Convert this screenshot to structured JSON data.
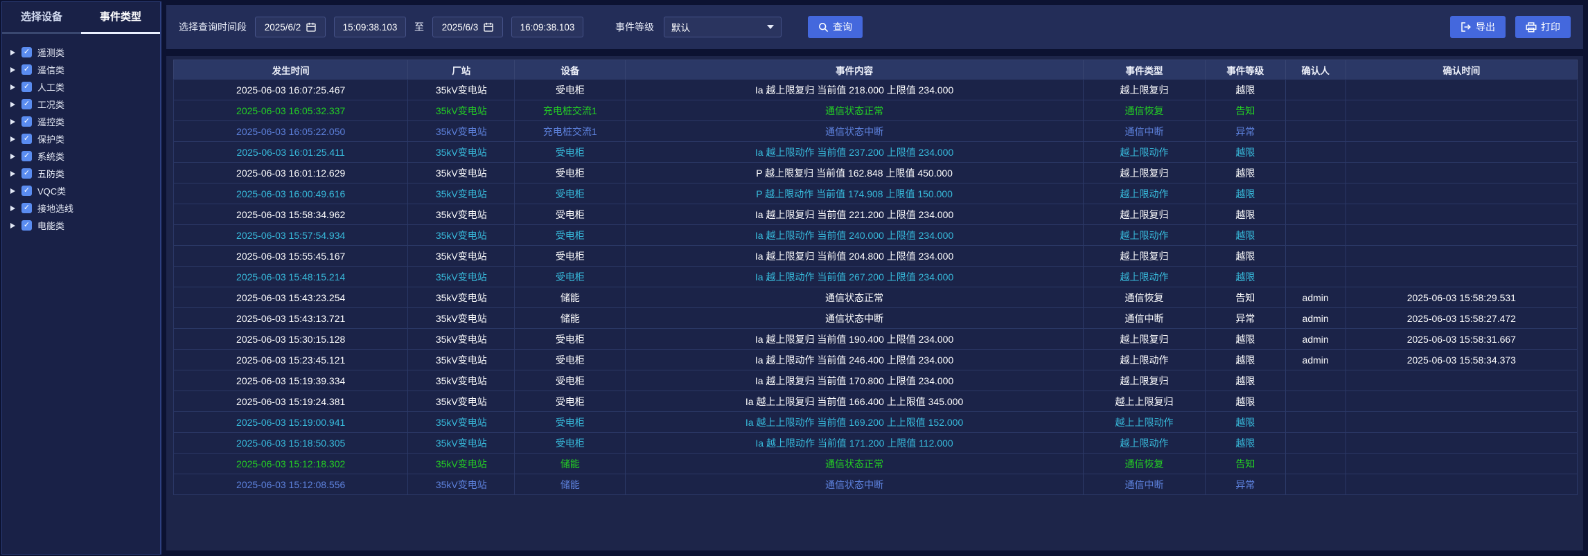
{
  "sidebar": {
    "tabs": [
      {
        "label": "选择设备",
        "active": false
      },
      {
        "label": "事件类型",
        "active": true
      }
    ],
    "tree_items": [
      "遥测类",
      "遥信类",
      "人工类",
      "工况类",
      "遥控类",
      "保护类",
      "系统类",
      "五防类",
      "VQC类",
      "接地选线",
      "电能类"
    ]
  },
  "toolbar": {
    "time_range_label": "选择查询时间段",
    "start_date": "2025/6/2",
    "start_time": "15:09:38.103",
    "to_label": "至",
    "end_date": "2025/6/3",
    "end_time": "16:09:38.103",
    "event_level_label": "事件等级",
    "event_level_value": "默认",
    "query_label": "查询",
    "export_label": "导出",
    "print_label": "打印"
  },
  "table": {
    "columns": [
      "发生时间",
      "厂站",
      "设备",
      "事件内容",
      "事件类型",
      "事件等级",
      "确认人",
      "确认时间"
    ],
    "rows": [
      {
        "time": "2025-06-03 16:07:25.467",
        "station": "35kV变电站",
        "device": "受电柜",
        "content": "Ia 越上限复归 当前值 218.000 上限值 234.000",
        "type": "越上限复归",
        "level": "越限",
        "confirmer": "",
        "confirm_time": "",
        "color": "white"
      },
      {
        "time": "2025-06-03 16:05:32.337",
        "station": "35kV变电站",
        "device": "充电桩交流1",
        "content": "通信状态正常",
        "type": "通信恢复",
        "level": "告知",
        "confirmer": "",
        "confirm_time": "",
        "color": "green"
      },
      {
        "time": "2025-06-03 16:05:22.050",
        "station": "35kV变电站",
        "device": "充电桩交流1",
        "content": "通信状态中断",
        "type": "通信中断",
        "level": "异常",
        "confirmer": "",
        "confirm_time": "",
        "color": "blue"
      },
      {
        "time": "2025-06-03 16:01:25.411",
        "station": "35kV变电站",
        "device": "受电柜",
        "content": "Ia 越上限动作 当前值 237.200 上限值 234.000",
        "type": "越上限动作",
        "level": "越限",
        "confirmer": "",
        "confirm_time": "",
        "color": "cyan"
      },
      {
        "time": "2025-06-03 16:01:12.629",
        "station": "35kV变电站",
        "device": "受电柜",
        "content": "P 越上限复归 当前值 162.848 上限值 450.000",
        "type": "越上限复归",
        "level": "越限",
        "confirmer": "",
        "confirm_time": "",
        "color": "white"
      },
      {
        "time": "2025-06-03 16:00:49.616",
        "station": "35kV变电站",
        "device": "受电柜",
        "content": "P 越上限动作 当前值 174.908 上限值 150.000",
        "type": "越上限动作",
        "level": "越限",
        "confirmer": "",
        "confirm_time": "",
        "color": "cyan"
      },
      {
        "time": "2025-06-03 15:58:34.962",
        "station": "35kV变电站",
        "device": "受电柜",
        "content": "Ia 越上限复归 当前值 221.200 上限值 234.000",
        "type": "越上限复归",
        "level": "越限",
        "confirmer": "",
        "confirm_time": "",
        "color": "white"
      },
      {
        "time": "2025-06-03 15:57:54.934",
        "station": "35kV变电站",
        "device": "受电柜",
        "content": "Ia 越上限动作 当前值 240.000 上限值 234.000",
        "type": "越上限动作",
        "level": "越限",
        "confirmer": "",
        "confirm_time": "",
        "color": "cyan"
      },
      {
        "time": "2025-06-03 15:55:45.167",
        "station": "35kV变电站",
        "device": "受电柜",
        "content": "Ia 越上限复归 当前值 204.800 上限值 234.000",
        "type": "越上限复归",
        "level": "越限",
        "confirmer": "",
        "confirm_time": "",
        "color": "white"
      },
      {
        "time": "2025-06-03 15:48:15.214",
        "station": "35kV变电站",
        "device": "受电柜",
        "content": "Ia 越上限动作 当前值 267.200 上限值 234.000",
        "type": "越上限动作",
        "level": "越限",
        "confirmer": "",
        "confirm_time": "",
        "color": "cyan"
      },
      {
        "time": "2025-06-03 15:43:23.254",
        "station": "35kV变电站",
        "device": "储能",
        "content": "通信状态正常",
        "type": "通信恢复",
        "level": "告知",
        "confirmer": "admin",
        "confirm_time": "2025-06-03 15:58:29.531",
        "color": "white"
      },
      {
        "time": "2025-06-03 15:43:13.721",
        "station": "35kV变电站",
        "device": "储能",
        "content": "通信状态中断",
        "type": "通信中断",
        "level": "异常",
        "confirmer": "admin",
        "confirm_time": "2025-06-03 15:58:27.472",
        "color": "white"
      },
      {
        "time": "2025-06-03 15:30:15.128",
        "station": "35kV变电站",
        "device": "受电柜",
        "content": "Ia 越上限复归 当前值 190.400 上限值 234.000",
        "type": "越上限复归",
        "level": "越限",
        "confirmer": "admin",
        "confirm_time": "2025-06-03 15:58:31.667",
        "color": "white"
      },
      {
        "time": "2025-06-03 15:23:45.121",
        "station": "35kV变电站",
        "device": "受电柜",
        "content": "Ia 越上限动作 当前值 246.400 上限值 234.000",
        "type": "越上限动作",
        "level": "越限",
        "confirmer": "admin",
        "confirm_time": "2025-06-03 15:58:34.373",
        "color": "white"
      },
      {
        "time": "2025-06-03 15:19:39.334",
        "station": "35kV变电站",
        "device": "受电柜",
        "content": "Ia 越上限复归 当前值 170.800 上限值 234.000",
        "type": "越上限复归",
        "level": "越限",
        "confirmer": "",
        "confirm_time": "",
        "color": "white"
      },
      {
        "time": "2025-06-03 15:19:24.381",
        "station": "35kV变电站",
        "device": "受电柜",
        "content": "Ia 越上上限复归 当前值 166.400 上上限值 345.000",
        "type": "越上上限复归",
        "level": "越限",
        "confirmer": "",
        "confirm_time": "",
        "color": "white"
      },
      {
        "time": "2025-06-03 15:19:00.941",
        "station": "35kV变电站",
        "device": "受电柜",
        "content": "Ia 越上上限动作 当前值 169.200 上上限值 152.000",
        "type": "越上上限动作",
        "level": "越限",
        "confirmer": "",
        "confirm_time": "",
        "color": "cyan"
      },
      {
        "time": "2025-06-03 15:18:50.305",
        "station": "35kV变电站",
        "device": "受电柜",
        "content": "Ia 越上限动作 当前值 171.200 上限值 112.000",
        "type": "越上限动作",
        "level": "越限",
        "confirmer": "",
        "confirm_time": "",
        "color": "cyan"
      },
      {
        "time": "2025-06-03 15:12:18.302",
        "station": "35kV变电站",
        "device": "储能",
        "content": "通信状态正常",
        "type": "通信恢复",
        "level": "告知",
        "confirmer": "",
        "confirm_time": "",
        "color": "green"
      },
      {
        "time": "2025-06-03 15:12:08.556",
        "station": "35kV变电站",
        "device": "储能",
        "content": "通信状态中断",
        "type": "通信中断",
        "level": "异常",
        "confirmer": "",
        "confirm_time": "",
        "color": "blue"
      }
    ]
  },
  "colors": {
    "white": "#ffffff",
    "green": "#24cf24",
    "cyan": "#38bbdc",
    "blue": "#5d81dc",
    "accent": "#4468dd",
    "checkbox": "#5a8cf0"
  },
  "icons": {
    "checkbox_check": "✓"
  }
}
